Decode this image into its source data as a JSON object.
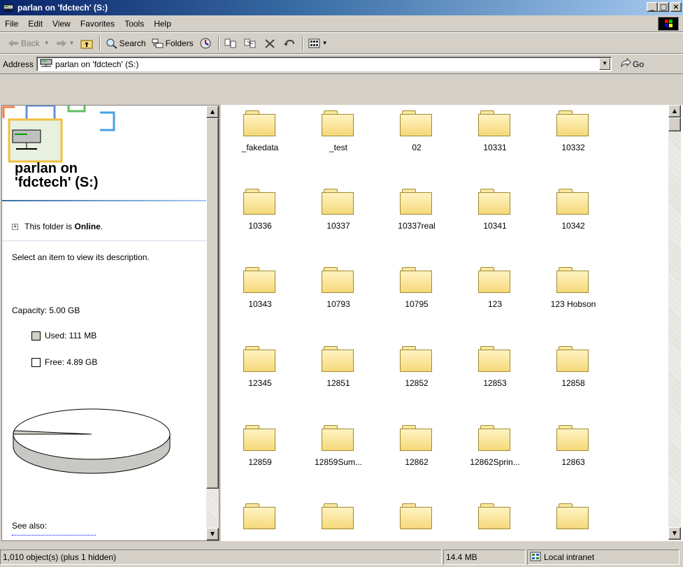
{
  "window": {
    "title": "parlan on 'fdctech' (S:)"
  },
  "menu": [
    "File",
    "Edit",
    "View",
    "Favorites",
    "Tools",
    "Help"
  ],
  "toolbar": {
    "back": "Back",
    "search": "Search",
    "folders": "Folders"
  },
  "address": {
    "label": "Address",
    "value": "parlan on 'fdctech' (S:)",
    "go": "Go"
  },
  "left_pane": {
    "title_line1": "parlan on",
    "title_line2": "'fdctech' (S:)",
    "online_prefix": "This folder is ",
    "online_status": "Online",
    "online_suffix": ".",
    "description": "Select an item to view its description.",
    "capacity": "Capacity: 5.00 GB",
    "used": "Used: 111 MB",
    "free": "Free: 4.89 GB",
    "used_fraction": 0.022,
    "see_also": "See also:"
  },
  "folders": [
    "_fakedata",
    "_test",
    "02",
    "10331",
    "10332",
    "10336",
    "10337",
    "10337real",
    "10341",
    "10342",
    "10343",
    "10793",
    "10795",
    "123",
    "123 Hobson",
    "12345",
    "12851",
    "12852",
    "12853",
    "12858",
    "12859",
    "12859Sum...",
    "12862",
    "12862Sprin...",
    "12863",
    "",
    "",
    "",
    "",
    ""
  ],
  "status": {
    "objects": "1,010 object(s) (plus 1 hidden)",
    "size": "14.4 MB",
    "zone": "Local intranet"
  },
  "colors": {
    "title_active": "#0a246a",
    "folder_fill": "#f5d97a",
    "window_face": "#d4d0c8"
  }
}
